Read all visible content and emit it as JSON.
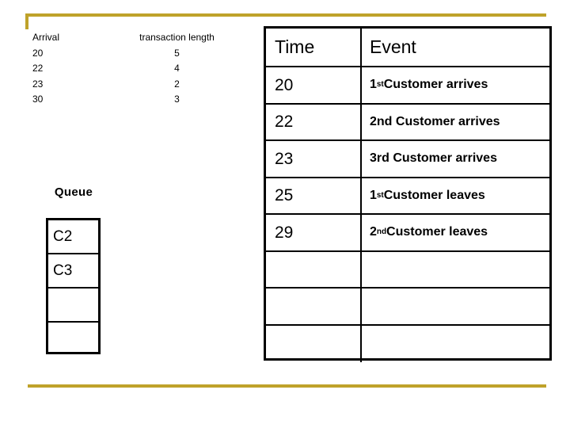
{
  "slide": {
    "accent_color": "#bfa22a",
    "background_color": "#ffffff",
    "text_color": "#000000"
  },
  "arrival_table": {
    "headers": {
      "arrival": "Arrival",
      "transaction_length": "transaction length"
    },
    "rows": [
      {
        "arrival": "20",
        "length": "5"
      },
      {
        "arrival": "22",
        "length": "4"
      },
      {
        "arrival": "23",
        "length": "2"
      },
      {
        "arrival": "30",
        "length": "3"
      }
    ]
  },
  "queue": {
    "label": "Queue",
    "cells": [
      "C2",
      "C3",
      "",
      ""
    ]
  },
  "event_table": {
    "headers": {
      "time": "Time",
      "event": "Event"
    },
    "rows": [
      {
        "time": "20",
        "event_ordinal": "1",
        "event_suffix": "st",
        "event_text": " Customer arrives"
      },
      {
        "time": "22",
        "event_ordinal": "2",
        "event_suffix": "nd",
        "event_text": " Customer arrives",
        "inline": true
      },
      {
        "time": "23",
        "event_ordinal": "3",
        "event_suffix": "rd",
        "event_text": " Customer arrives",
        "inline": true
      },
      {
        "time": "25",
        "event_ordinal": "1",
        "event_suffix": "st",
        "event_text": " Customer leaves"
      },
      {
        "time": "29",
        "event_ordinal": "2",
        "event_suffix": "nd",
        "event_text": " Customer leaves"
      },
      {
        "time": "",
        "event_ordinal": "",
        "event_suffix": "",
        "event_text": ""
      },
      {
        "time": "",
        "event_ordinal": "",
        "event_suffix": "",
        "event_text": ""
      },
      {
        "time": "",
        "event_ordinal": "",
        "event_suffix": "",
        "event_text": ""
      }
    ]
  }
}
